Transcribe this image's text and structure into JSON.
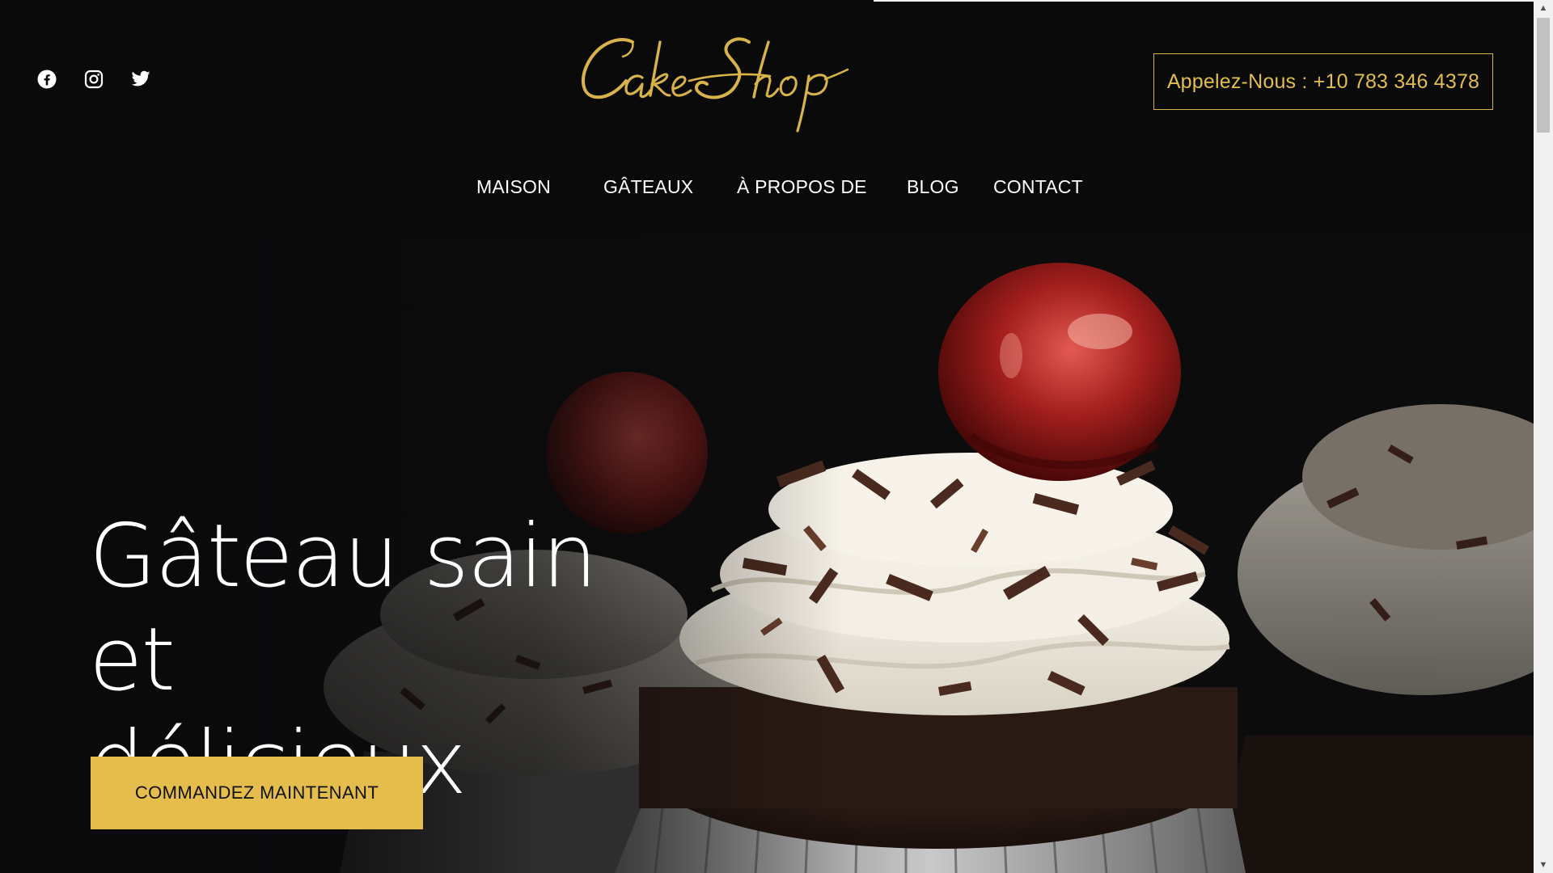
{
  "header": {
    "social_icons": [
      "facebook-icon",
      "instagram-icon",
      "twitter-icon"
    ],
    "logo_text": "Cake Shop",
    "call_button": "Appelez-Nous : +10 783 346 4378"
  },
  "nav": {
    "items": [
      {
        "label": "MAISON"
      },
      {
        "label": "GÂTEAUX"
      },
      {
        "label": "À PROPOS DE"
      },
      {
        "label": "BLOG"
      },
      {
        "label": "CONTACT"
      }
    ]
  },
  "hero": {
    "headline_line1": "Gâteau sain et",
    "headline_line2": "délicieux",
    "cta": "COMMANDEZ MAINTENANT"
  },
  "colors": {
    "background": "#0a0a0b",
    "accent_gold": "#e4bd4c",
    "text": "#ffffff"
  }
}
